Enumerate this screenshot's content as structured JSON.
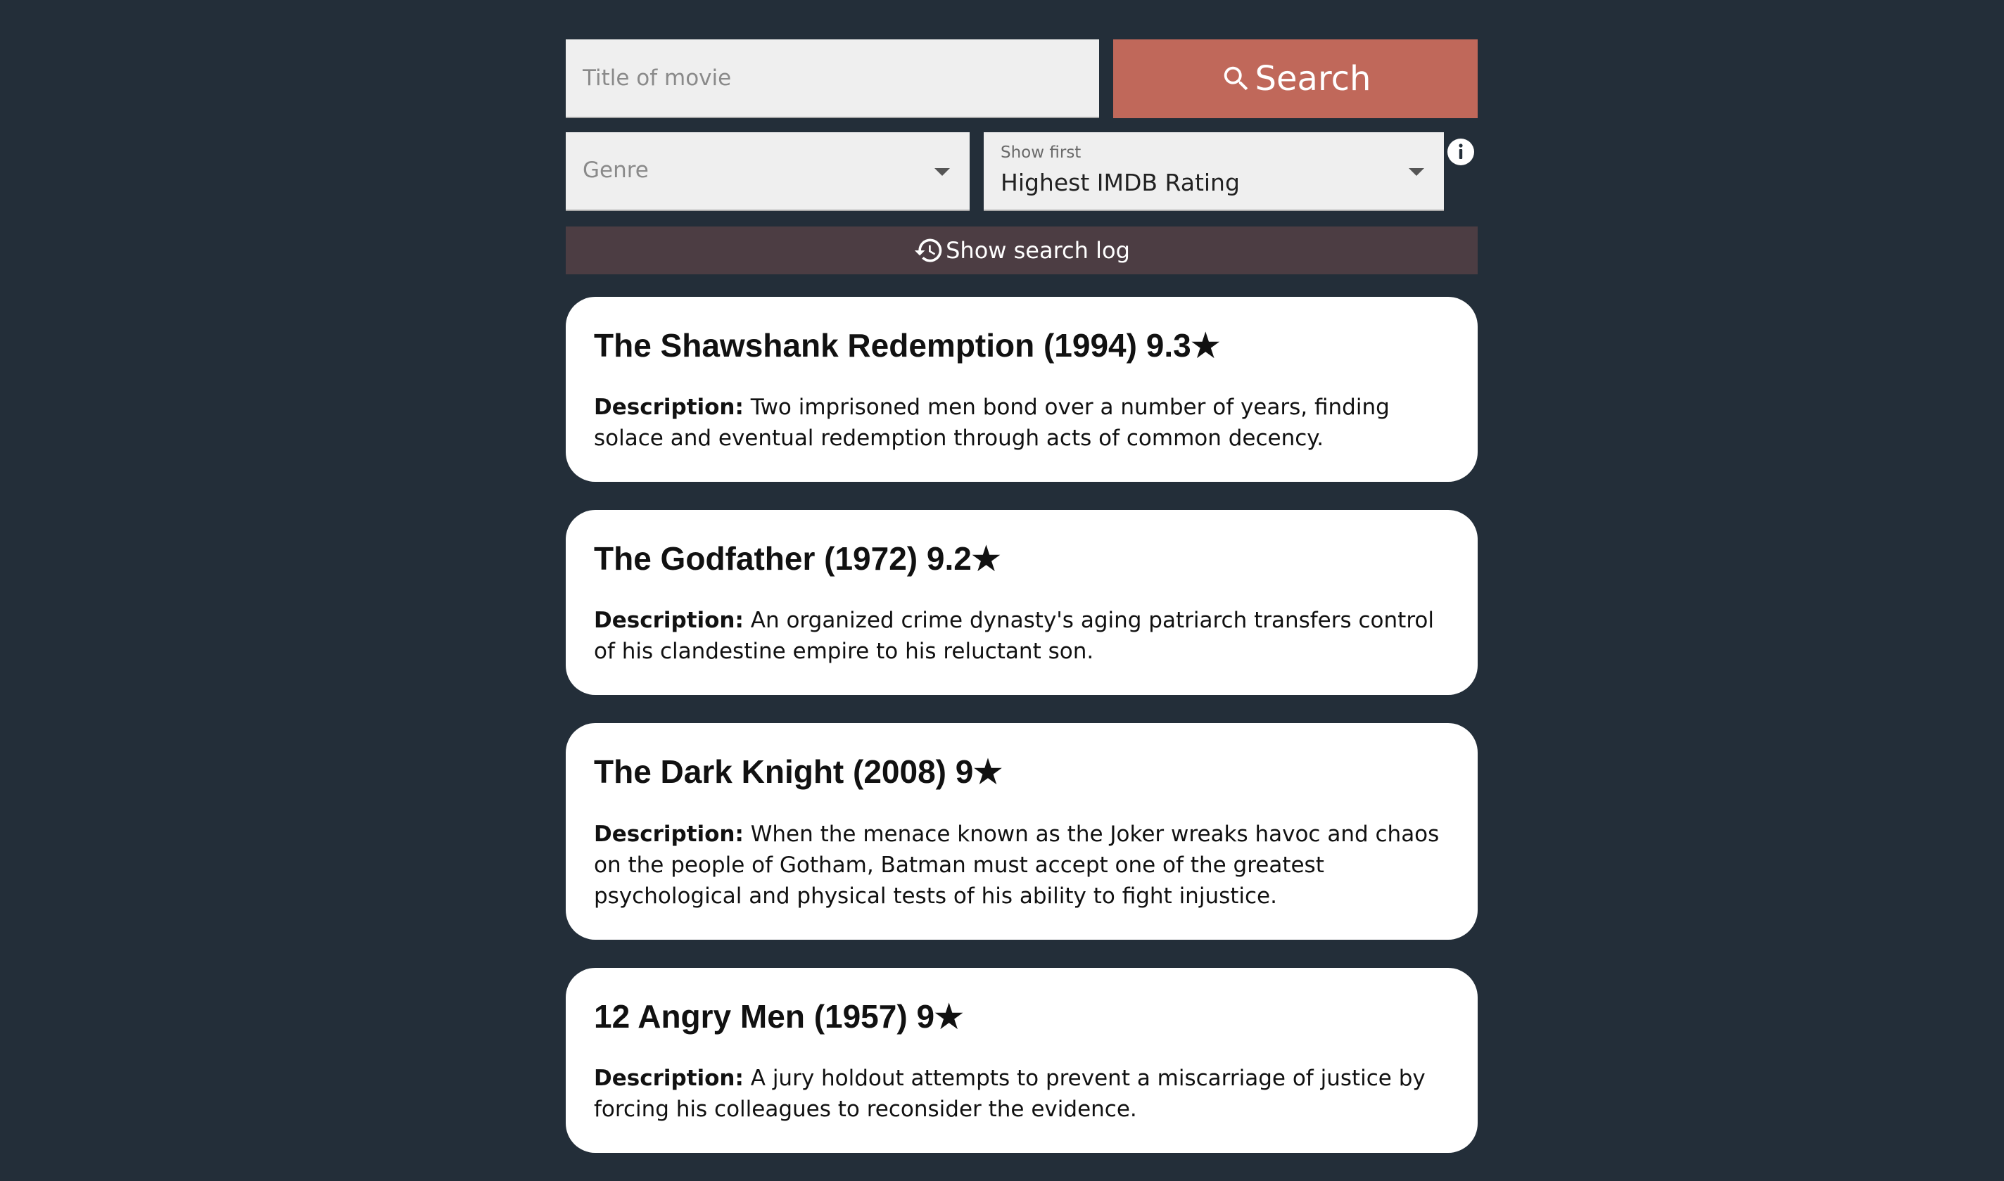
{
  "search": {
    "title_placeholder": "Title of movie",
    "button_label": "Search",
    "button_color": "#c0685a"
  },
  "filters": {
    "genre_placeholder": "Genre",
    "sort_label": "Show first",
    "sort_value": "Highest IMDB Rating"
  },
  "log": {
    "label": "Show search log"
  },
  "movies": [
    {
      "heading": "The Shawshank Redemption (1994) 9.3★",
      "description_label": "Description:",
      "description": " Two imprisoned men bond over a number of years, finding solace and eventual redemption through acts of common decency."
    },
    {
      "heading": "The Godfather (1972) 9.2★",
      "description_label": "Description:",
      "description": " An organized crime dynasty's aging patriarch transfers control of his clandestine empire to his reluctant son."
    },
    {
      "heading": "The Dark Knight (2008) 9★",
      "description_label": "Description:",
      "description": " When the menace known as the Joker wreaks havoc and chaos on the people of Gotham, Batman must accept one of the greatest psychological and physical tests of his ability to fight injustice."
    },
    {
      "heading": "12 Angry Men (1957) 9★",
      "description_label": "Description:",
      "description": " A jury holdout attempts to prevent a miscarriage of justice by forcing his colleagues to reconsider the evidence."
    }
  ],
  "icons": {
    "search": "search-icon",
    "history": "history-icon",
    "info": "info-icon",
    "dropdown": "chevron-down-icon"
  }
}
